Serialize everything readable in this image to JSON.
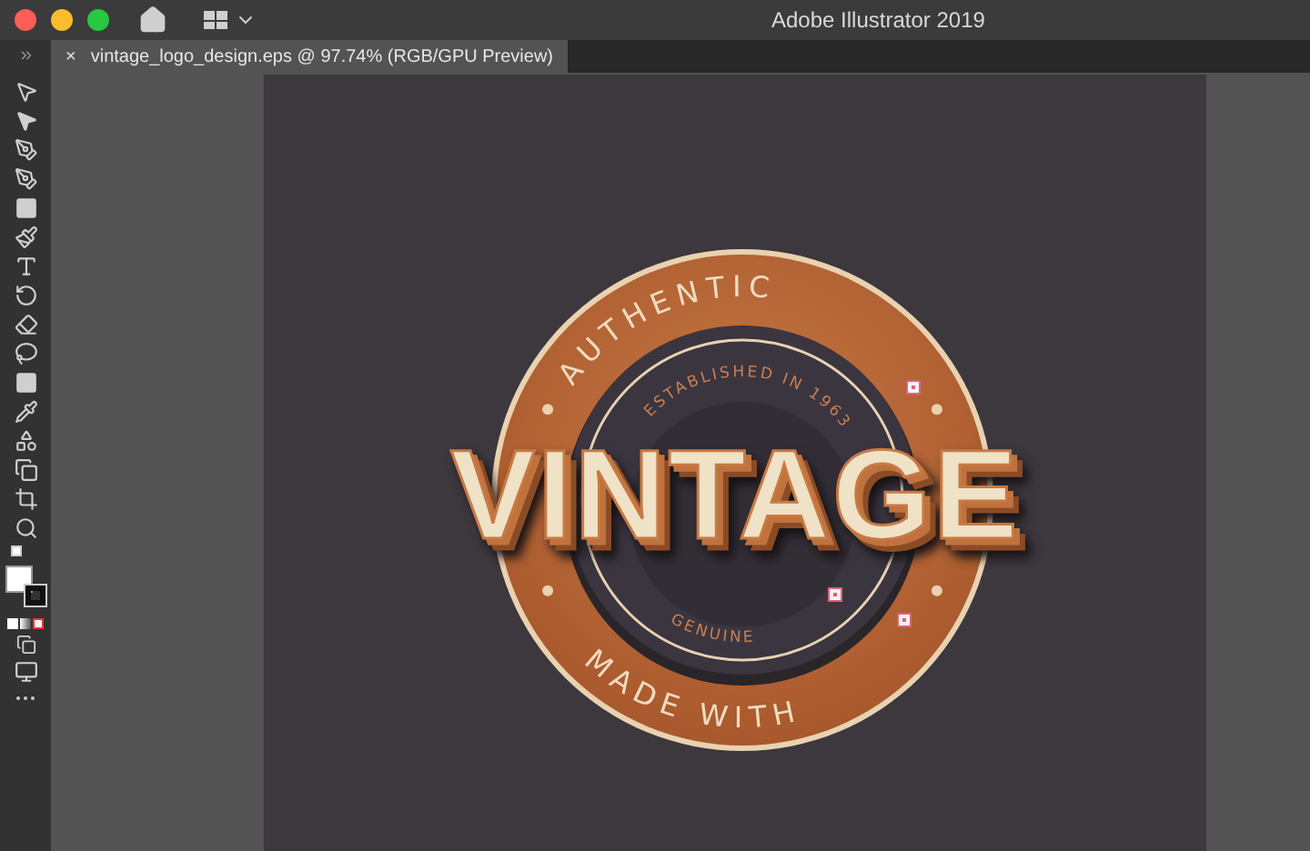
{
  "window": {
    "title": "Adobe Illustrator 2019"
  },
  "document_tab": {
    "close": "×",
    "title": "vintage_logo_design.eps @ 97.74% (RGB/GPU Preview)",
    "selected": true
  },
  "artwork": {
    "outer_top_arc": "AUTHENTIC",
    "inner_top_arc": "ESTABLISHED IN 1963",
    "headline": "VINTAGE",
    "inner_bottom_arc": "GENUINE",
    "outer_bottom_arc": "MADE WITH"
  }
}
